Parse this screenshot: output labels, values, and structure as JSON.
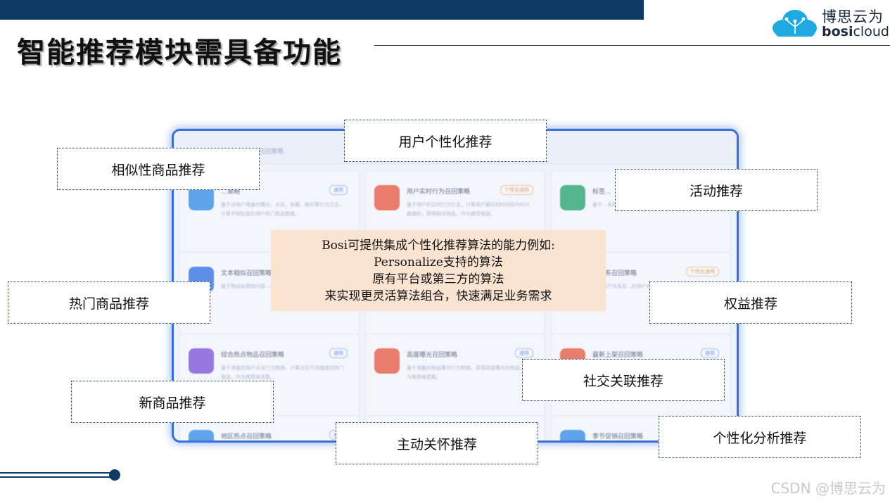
{
  "header": {
    "title": "智能推荐模块需具备功能",
    "logo_cn": "博思云为",
    "logo_en_bold": "bosi",
    "logo_en_rest": "cloud"
  },
  "screenshot": {
    "header_text": "召回策略",
    "cards": [
      {
        "title": "…策略",
        "desc": "基于对用户海量的曝光、点击、收藏、购买等行为日志，计算不同粒度的用户热门商品数据。",
        "tag": "通用",
        "tag_style": "blue",
        "icon_color": "#2f8be6"
      },
      {
        "title": "用户实时行为召回策略",
        "desc": "基于用户的实时行为日志，计算用户最近的时间段内的兴趣偏好，获得相关物品，作为推荐候选。",
        "tag": "个性化通用",
        "tag_style": "orange",
        "icon_color": "#e8553d"
      },
      {
        "title": "标签…",
        "desc": "基于…关的物品…",
        "tag": "",
        "tag_style": "blue",
        "icon_color": "#22a36b"
      },
      {
        "title": "文本相似召回策略",
        "desc": "基于物品标题和内容…相似度获取相似物品，作为…",
        "tag": "",
        "tag_style": "blue",
        "icon_color": "#2f6fe0"
      },
      {
        "title": "",
        "desc": "",
        "tag": "",
        "tag_style": "blue",
        "icon_color": "#f6f8fd"
      },
      {
        "title": "…关系召回策略",
        "desc": "基于用户关系及…的用户社交…",
        "tag": "个性化通用",
        "tag_style": "orange",
        "icon_color": "#e8553d"
      },
      {
        "title": "综合热点物品召回策略",
        "desc": "基于海量的用户点击行为数据，计算出在不同维度的热门物品，作为推荐候选集。",
        "tag": "通用",
        "tag_style": "blue",
        "icon_color": "#7a4fd8"
      },
      {
        "title": "高度曝光召回策略",
        "desc": "基于海量的物品曝光行为数据，获得高度曝光的物品，作为推荐候选集。",
        "tag": "通用",
        "tag_style": "blue",
        "icon_color": "#e8553d"
      },
      {
        "title": "最新上架召回策略",
        "desc": "",
        "tag": "通用",
        "tag_style": "blue",
        "icon_color": "#e8553d"
      },
      {
        "title": "地区热点召回策略",
        "desc": "",
        "tag": "通用",
        "tag_style": "blue",
        "icon_color": "#2f8be6"
      },
      {
        "title": "",
        "desc": "",
        "tag": "",
        "tag_style": "blue",
        "icon_color": "#f6f8fd"
      },
      {
        "title": "季节促销召回策略",
        "desc": "",
        "tag": "",
        "tag_style": "blue",
        "icon_color": "#2f8be6"
      }
    ]
  },
  "labels": {
    "user_personal": "用户个性化推荐",
    "similar_goods": "相似性商品推荐",
    "activity": "活动推荐",
    "hot_goods": "热门商品推荐",
    "benefits": "权益推荐",
    "social": "社交关联推荐",
    "new_goods": "新商品推荐",
    "care": "主动关怀推荐",
    "analysis": "个性化分析推荐"
  },
  "center_box": {
    "line1": "Bosi可提供集成个性化推荐算法的能力例如:",
    "line2": "Personalize支持的算法",
    "line3": "原有平台或第三方的算法",
    "line4": "来实现更灵活算法组合，快速满足业务需求"
  },
  "watermark": "CSDN @博思云为"
}
